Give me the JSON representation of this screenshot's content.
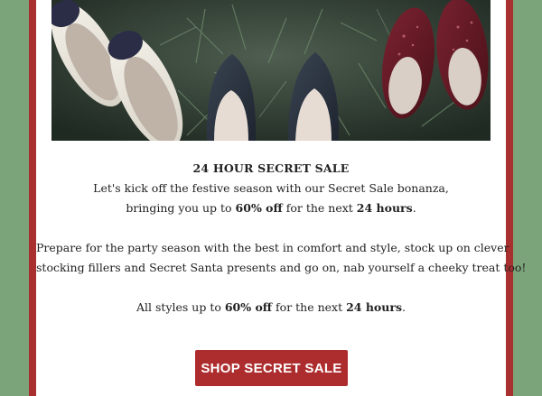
{
  "colors": {
    "background_green": "#7ca47a",
    "frame_red": "#a8302f",
    "button_red": "#ad2d2e",
    "text": "#222222"
  },
  "hero": {
    "image": "festive-shoes-banner"
  },
  "content": {
    "headline": "24 HOUR SECRET SALE",
    "intro_line1": "Let's kick off the festive season with our Secret Sale bonanza,",
    "intro_line2_prefix": "bringing you up to ",
    "intro_line2_bold1": "60% off",
    "intro_line2_middle": " for the next ",
    "intro_line2_bold2": "24 hours",
    "intro_line2_suffix": ".",
    "body_line1": "Prepare for the party season with the best in comfort and style, stock up on clever",
    "body_line2": "stocking fillers and Secret Santa presents and go on, nab yourself a cheeky treat too!",
    "closing_prefix": "All styles up to ",
    "closing_bold1": "60% off",
    "closing_middle": " for the next ",
    "closing_bold2": "24 hours",
    "closing_suffix": "."
  },
  "cta": {
    "label": "SHOP SECRET SALE"
  }
}
